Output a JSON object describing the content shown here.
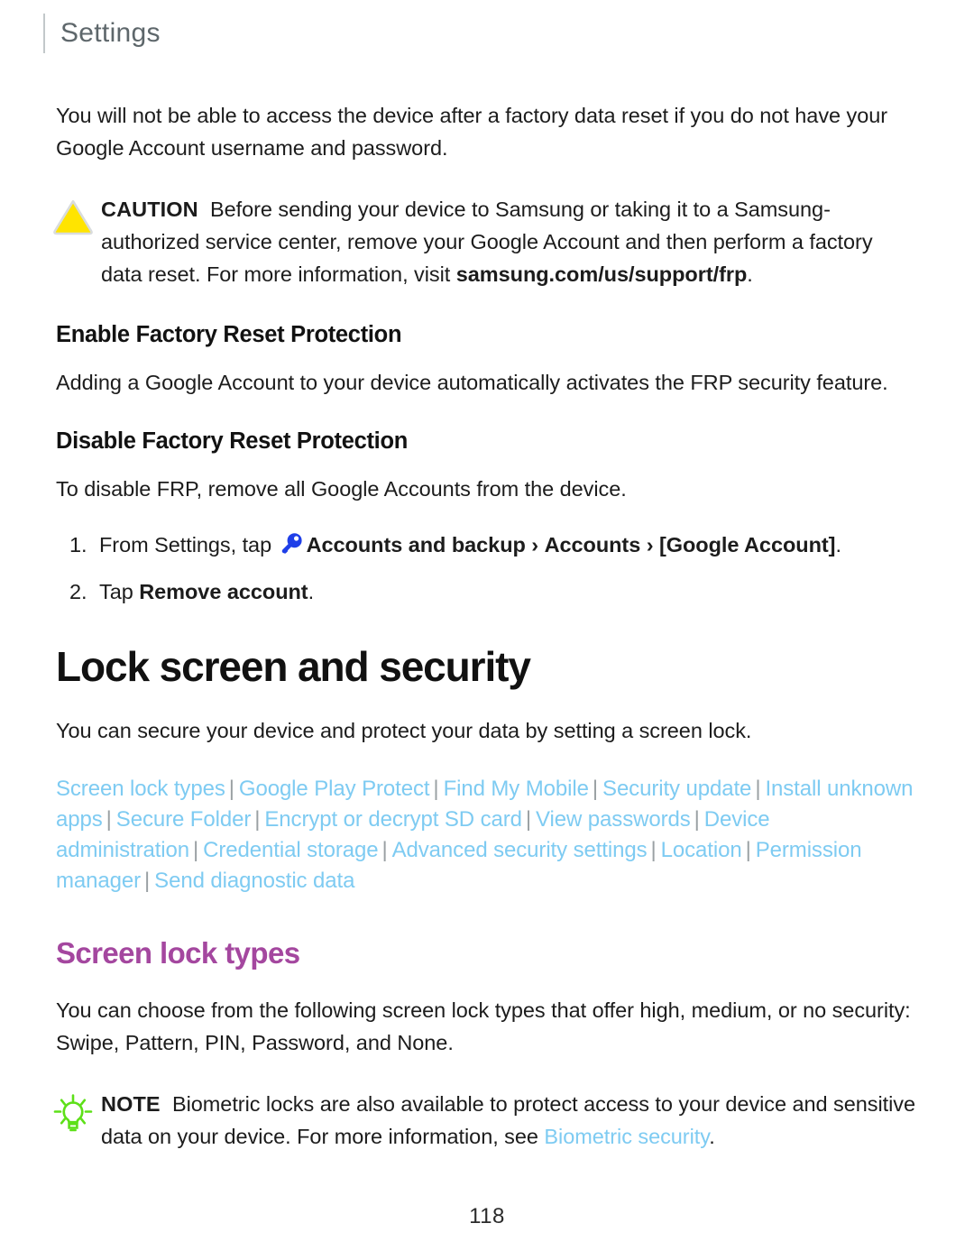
{
  "header": {
    "title": "Settings"
  },
  "intro": {
    "paragraph": "You will not be able to access the device after a factory data reset if you do not have your Google Account username and password."
  },
  "caution": {
    "icon": "warning-triangle-icon",
    "label": "CAUTION",
    "text_before_link": "Before sending your device to Samsung or taking it to a Samsung-authorized service center, remove your Google Account and then perform a factory data reset. For more information, visit ",
    "url_text": "samsung.com/us/support/frp",
    "text_after_link": ".",
    "icon_color": "#FFE400"
  },
  "enable_frp": {
    "heading": "Enable Factory Reset Protection",
    "paragraph": "Adding a Google Account to your device automatically activates the FRP security feature."
  },
  "disable_frp": {
    "heading": "Disable Factory Reset Protection",
    "paragraph": "To disable FRP, remove all Google Accounts from the device.",
    "steps": [
      {
        "lead": "From Settings, tap ",
        "icon": "key-icon",
        "icon_color": "#1F3FE8",
        "path_bold_1": "Accounts and backup",
        "arrow_1": "›",
        "path_bold_2": "Accounts",
        "arrow_2": "›",
        "path_bold_3": "[Google Account]",
        "tail": "."
      },
      {
        "lead": "Tap ",
        "bold": "Remove account",
        "tail": "."
      }
    ]
  },
  "chapter": {
    "title": "Lock screen and security",
    "intro": "You can secure your device and protect your data by setting a screen lock."
  },
  "xref_links": [
    "Screen lock types",
    "Google Play Protect",
    "Find My Mobile",
    "Security update",
    "Install unknown apps",
    "Secure Folder",
    "Encrypt or decrypt SD card",
    "View passwords",
    "Device administration",
    "Credential storage",
    "Advanced security settings",
    "Location",
    "Permission manager",
    "Send diagnostic data"
  ],
  "xref_separator": "|",
  "screen_lock_types": {
    "heading": "Screen lock types",
    "heading_color": "#A4479F",
    "paragraph": "You can choose from the following screen lock types that offer high, medium, or no security: Swipe, Pattern, PIN, Password, and None."
  },
  "note": {
    "icon": "lightbulb-icon",
    "icon_color": "#5DE018",
    "label": "NOTE",
    "text_before_link": "Biometric locks are also available to protect access to your device and sensitive data on your device. For more information, see ",
    "link_text": "Biometric security",
    "text_after_link": "."
  },
  "footer": {
    "page_number": "118"
  },
  "colors": {
    "link": "#7ECBF2",
    "accent_purple": "#A4479F",
    "header_gray": "#5E676B",
    "body": "#1C1C1C"
  }
}
